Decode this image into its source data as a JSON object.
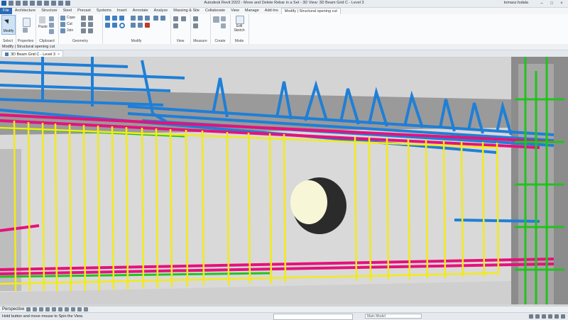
{
  "window": {
    "title": "Autodesk Revit 2022 - Move and Delete Rebar in a Set - 3D View: 3D Beam Grid C - Level 3",
    "user": "tomasz.fudala"
  },
  "tabs": [
    "File",
    "Architecture",
    "Structure",
    "Steel",
    "Precast",
    "Systems",
    "Insert",
    "Annotate",
    "Analyze",
    "Massing & Site",
    "Collaborate",
    "View",
    "Manage",
    "Add-Ins",
    "Modify | Structural opening cut"
  ],
  "ribbon": {
    "modify_label": "Modify",
    "panels": {
      "select": "Select",
      "properties": "Properties",
      "clipboard": "Clipboard",
      "geometry": "Geometry",
      "modify": "Modify",
      "view": "View",
      "measure": "Measure",
      "create": "Create",
      "mode": "Mode"
    },
    "clipboard": {
      "paste": "Paste"
    },
    "geometry": {
      "cope": "Cope",
      "cut": "Cut",
      "join": "Join"
    },
    "mode": {
      "edit_sketch": "Edit\nSketch"
    }
  },
  "options_bar": {
    "text": "Modify | Structural opening cut"
  },
  "view_tab": {
    "label": "3D Beam Grid C - Level 3",
    "close": "×"
  },
  "view_control": {
    "mode": "Perspective"
  },
  "status_bar": {
    "message": "Hold button and move mouse to Spin the View.",
    "model": "Main Model"
  }
}
